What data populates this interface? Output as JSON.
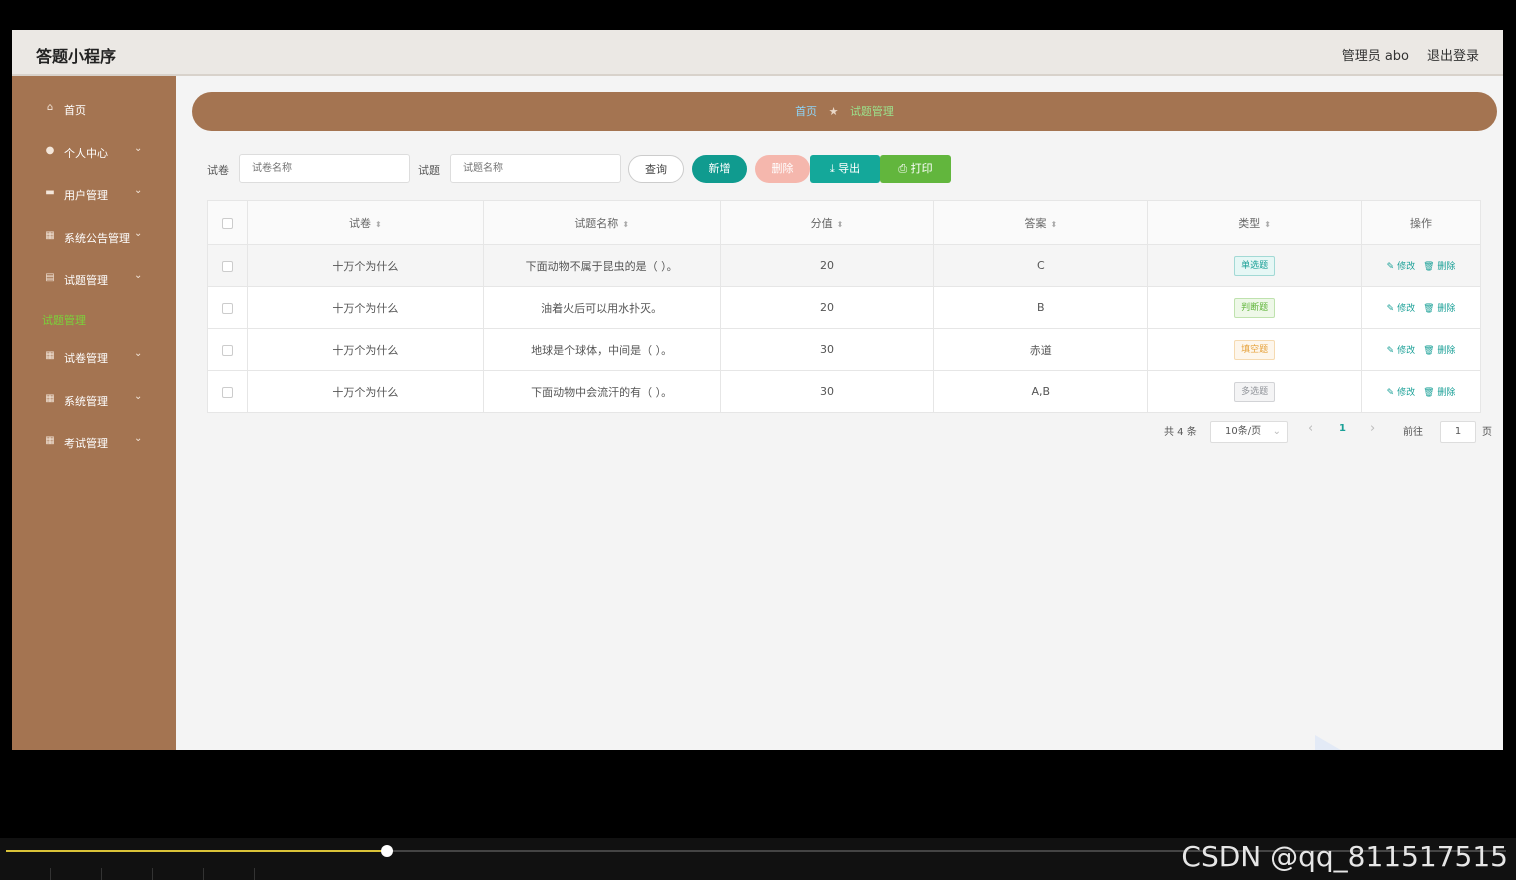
{
  "app": {
    "title": "答题小程序",
    "admin_label": "管理员 abo",
    "logout_label": "退出登录"
  },
  "sidebar": {
    "items": [
      {
        "label": "首页",
        "icon": "home-icon",
        "glyph": "⌂",
        "has_children": false
      },
      {
        "label": "个人中心",
        "icon": "user-icon",
        "glyph": "●",
        "has_children": true
      },
      {
        "label": "用户管理",
        "icon": "monitor-icon",
        "glyph": "▬",
        "has_children": true
      },
      {
        "label": "系统公告管理",
        "icon": "grid-icon",
        "glyph": "▦",
        "has_children": true
      },
      {
        "label": "试题管理",
        "icon": "clipboard-icon",
        "glyph": "▤",
        "has_children": true
      },
      {
        "label": "试卷管理",
        "icon": "grid-icon",
        "glyph": "▦",
        "has_children": true
      },
      {
        "label": "系统管理",
        "icon": "grid-icon",
        "glyph": "▦",
        "has_children": true
      },
      {
        "label": "考试管理",
        "icon": "grid-icon",
        "glyph": "▦",
        "has_children": true
      }
    ],
    "active_sub": "试题管理",
    "chevron": "⌄"
  },
  "breadcrumb": {
    "home": "首页",
    "separator": "★",
    "current": "试题管理"
  },
  "filters": {
    "paper_label": "试卷",
    "paper_placeholder": "试卷名称",
    "question_label": "试题",
    "question_placeholder": "试题名称"
  },
  "buttons": {
    "query": "查询",
    "add": "新增",
    "delete": "删除",
    "export": "⤓ 导出",
    "print": "⎙ 打印"
  },
  "table": {
    "headers": [
      "试卷",
      "试题名称",
      "分值",
      "答案",
      "类型",
      "操作"
    ],
    "sort_glyph": "⬍",
    "rows": [
      {
        "paper": "十万个为什么",
        "question": "下面动物不属于昆虫的是（ ）。",
        "score": "20",
        "answer": "C",
        "type": "单选题",
        "type_color": "#1aa097",
        "type_bg": "#e6f7f5"
      },
      {
        "paper": "十万个为什么",
        "question": "油着火后可以用水扑灭。",
        "score": "20",
        "answer": "B",
        "type": "判断题",
        "type_color": "#62b63d",
        "type_bg": "#eef8e8"
      },
      {
        "paper": "十万个为什么",
        "question": "地球是个球体，中间是（ ）。",
        "score": "30",
        "answer": "赤道",
        "type": "填空题",
        "type_color": "#e6a23c",
        "type_bg": "#fdf6ec"
      },
      {
        "paper": "十万个为什么",
        "question": "下面动物中会流汗的有（ ）。",
        "score": "30",
        "answer": "A,B",
        "type": "多选题",
        "type_color": "#909399",
        "type_bg": "#f4f4f5"
      }
    ],
    "edit_label": "✎ 修改",
    "delete_label": "🗑 删除"
  },
  "pagination": {
    "total": "共 4 条",
    "page_size": "10条/页",
    "prev": "‹",
    "current_page": "1",
    "next": "›",
    "goto_label": "前往",
    "goto_value": "1",
    "page_suffix": "页"
  },
  "player": {
    "progress": 0.254,
    "watermark": "CSDN @qq_811517515",
    "fill_color": "#d9c238"
  }
}
